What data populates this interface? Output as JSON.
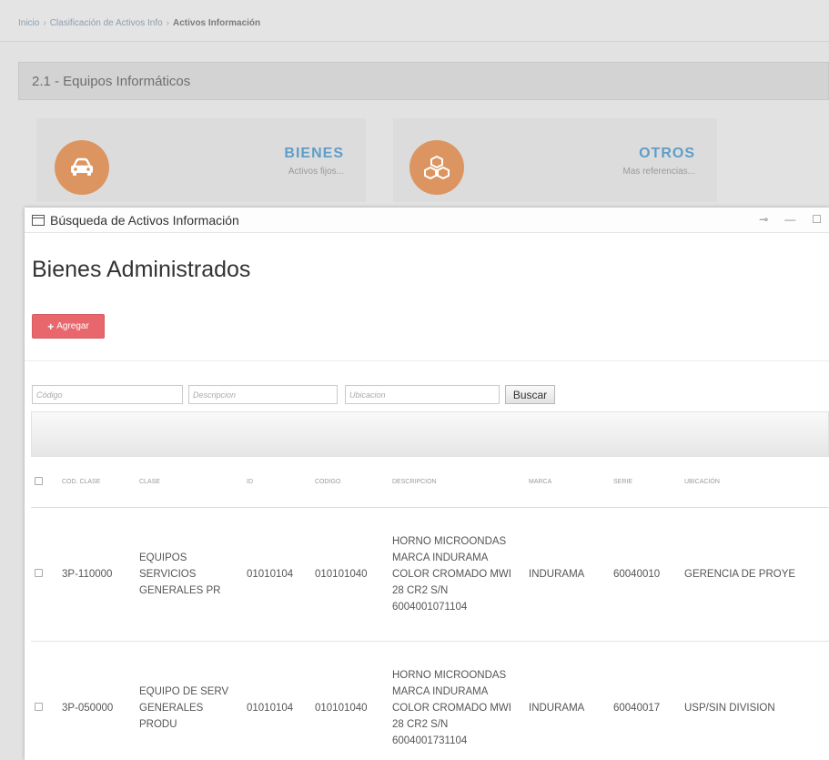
{
  "breadcrumb": {
    "items": [
      "Inicio",
      "Clasificación de Activos Info"
    ],
    "current": "Activos Información"
  },
  "section": {
    "title": "2.1 - Equipos Informáticos"
  },
  "cards": [
    {
      "title": "BIENES",
      "subtitle": "Activos fijos...",
      "icon": "car-icon"
    },
    {
      "title": "OTROS",
      "subtitle": "Mas referencias...",
      "icon": "cubes-icon"
    }
  ],
  "modal": {
    "title": "Búsqueda de Activos Información",
    "heading": "Bienes Administrados",
    "add_label": "Agregar",
    "search": {
      "codigo_placeholder": "Código",
      "descripcion_placeholder": "Descripcion",
      "ubicacion_placeholder": "Ubicacion",
      "button_label": "Buscar"
    },
    "table": {
      "headers": [
        "COD. CLASE",
        "CLASE",
        "ID",
        "CODIGO",
        "DESCRIPCION",
        "MARCA",
        "SERIE",
        "UBICACIÓN"
      ],
      "rows": [
        {
          "cod_clase": "3P-110000",
          "clase": "EQUIPOS SERVICIOS GENERALES PR",
          "id": "01010104",
          "codigo": "010101040",
          "descripcion": "HORNO MICROONDAS MARCA INDURAMA COLOR CROMADO MWI 28 CR2 S/N 6004001071104",
          "marca": "INDURAMA",
          "serie": "60040010",
          "ubicacion": "GERENCIA DE PROYE"
        },
        {
          "cod_clase": "3P-050000",
          "clase": "EQUIPO DE SERV GENERALES PRODU",
          "id": "01010104",
          "codigo": "010101040",
          "descripcion": "HORNO MICROONDAS MARCA INDURAMA COLOR CROMADO MWI 28 CR2 S/N 6004001731104",
          "marca": "INDURAMA",
          "serie": "60040017",
          "ubicacion": "USP/SIN DIVISION"
        }
      ]
    }
  },
  "colors": {
    "accent_orange": "#dc9560",
    "accent_blue": "#5f9ec7",
    "add_red": "#e8676c"
  }
}
